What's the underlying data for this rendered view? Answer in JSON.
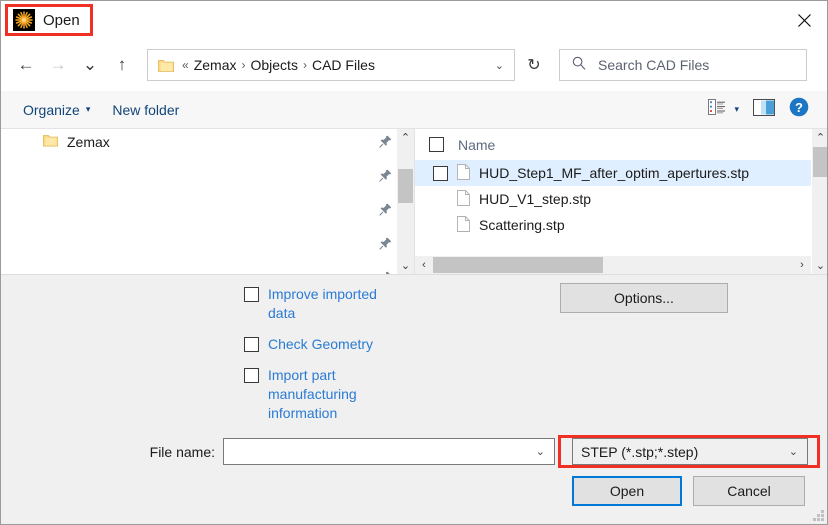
{
  "window": {
    "title": "Open",
    "app_icon": "zemax-starburst-icon",
    "close_label": "✕",
    "highlight_color": "#ee3124",
    "accent_color": "#0078d7",
    "link_color": "#2a7bd4"
  },
  "nav": {
    "back_label": "←",
    "forward_label": "→",
    "recent_label": "⌄",
    "up_label": "↑",
    "address": {
      "prefix": "«",
      "crumbs": [
        "Zemax",
        "Objects",
        "CAD Files"
      ],
      "separator": "›",
      "dropdown_label": "⌄"
    },
    "refresh_label": "↻",
    "search": {
      "placeholder": "Search CAD Files",
      "icon": "search-icon"
    }
  },
  "commandbar": {
    "organize_label": "Organize",
    "organize_caret": "▾",
    "new_folder_label": "New folder",
    "view_icon": "list-view-icon",
    "view_caret": "▾",
    "preview_pane_icon": "preview-pane-icon",
    "help_icon": "help-icon",
    "help_label": "?"
  },
  "navpane": {
    "items": [
      {
        "label": "Zemax",
        "icon": "folder-icon"
      }
    ],
    "pin_icon": "pin-icon",
    "pin_count": 5,
    "scroll_up": "⌃",
    "scroll_down": "⌄"
  },
  "filepane": {
    "column_header": "Name",
    "header_checkbox_checked": false,
    "files": [
      {
        "name": "HUD_Step1_MF_after_optim_apertures.stp",
        "selected": true,
        "has_checkbox": true,
        "icon": "document-icon"
      },
      {
        "name": "HUD_V1_step.stp",
        "selected": false,
        "has_checkbox": false,
        "icon": "document-icon"
      },
      {
        "name": "Scattering.stp",
        "selected": false,
        "has_checkbox": false,
        "icon": "document-icon"
      }
    ],
    "scroll_up": "⌃",
    "scroll_down": "⌄",
    "scroll_left": "‹",
    "scroll_right": "›"
  },
  "options": {
    "checkboxes": [
      {
        "label": "Improve imported data",
        "checked": false
      },
      {
        "label": "Check Geometry",
        "checked": false
      },
      {
        "label": "Import part manufacturing information",
        "checked": false
      }
    ],
    "options_button": "Options..."
  },
  "footer": {
    "filename_label": "File name:",
    "filename_value": "",
    "filename_placeholder": "",
    "filename_caret": "⌄",
    "filetype_value": "STEP (*.stp;*.step)",
    "filetype_caret": "⌄",
    "open_button": "Open",
    "cancel_button": "Cancel"
  }
}
